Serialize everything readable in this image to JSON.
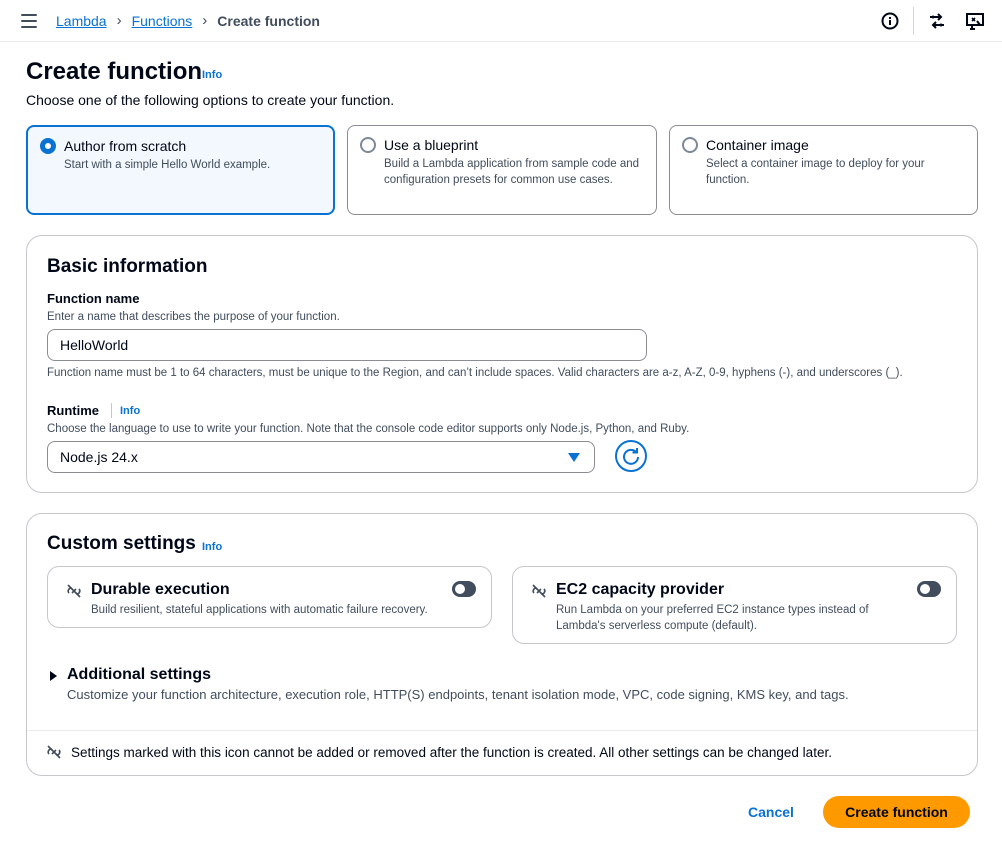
{
  "breadcrumbs": {
    "lambda": "Lambda",
    "functions": "Functions",
    "current": "Create function"
  },
  "header_icons": [
    "info-icon",
    "settings-sync-icon",
    "feedback-icon"
  ],
  "page": {
    "title": "Create function",
    "info": "Info",
    "description": "Choose one of the following options to create your function."
  },
  "options": [
    {
      "label": "Author from scratch",
      "description": "Start with a simple Hello World example.",
      "selected": true
    },
    {
      "label": "Use a blueprint",
      "description": "Build a Lambda application from sample code and configuration presets for common use cases.",
      "selected": false
    },
    {
      "label": "Container image",
      "description": "Select a container image to deploy for your function.",
      "selected": false
    }
  ],
  "basic_info": {
    "title": "Basic information",
    "function_name": {
      "label": "Function name",
      "description": "Enter a name that describes the purpose of your function.",
      "value": "HelloWorld",
      "constraint": "Function name must be 1 to 64 characters, must be unique to the Region, and can’t include spaces. Valid characters are a-z, A-Z, 0-9, hyphens (-), and underscores (_)."
    },
    "runtime": {
      "label": "Runtime",
      "info": "Info",
      "description": "Choose the language to use to write your function. Note that the console code editor supports only Node.js, Python, and Ruby.",
      "value": "Node.js 24.x"
    }
  },
  "custom_settings": {
    "title": "Custom settings",
    "info": "Info",
    "durable": {
      "title": "Durable execution",
      "description": "Build resilient, stateful applications with automatic failure recovery.",
      "enabled": false
    },
    "ec2": {
      "title": "EC2 capacity provider",
      "description": "Run Lambda on your preferred EC2 instance types instead of Lambda's serverless compute (default).",
      "enabled": false
    },
    "additional": {
      "title": "Additional settings",
      "description": "Customize your function architecture, execution role, HTTP(S) endpoints, tenant isolation mode, VPC, code signing, KMS key, and tags."
    },
    "footer_note": "Settings marked with this icon cannot be added or removed after the function is created. All other settings can be changed later."
  },
  "actions": {
    "cancel": "Cancel",
    "create": "Create function"
  },
  "colors": {
    "link": "#0972d3",
    "primary_button": "#ff9900",
    "selected_tile_bg": "#f2f8fd"
  }
}
